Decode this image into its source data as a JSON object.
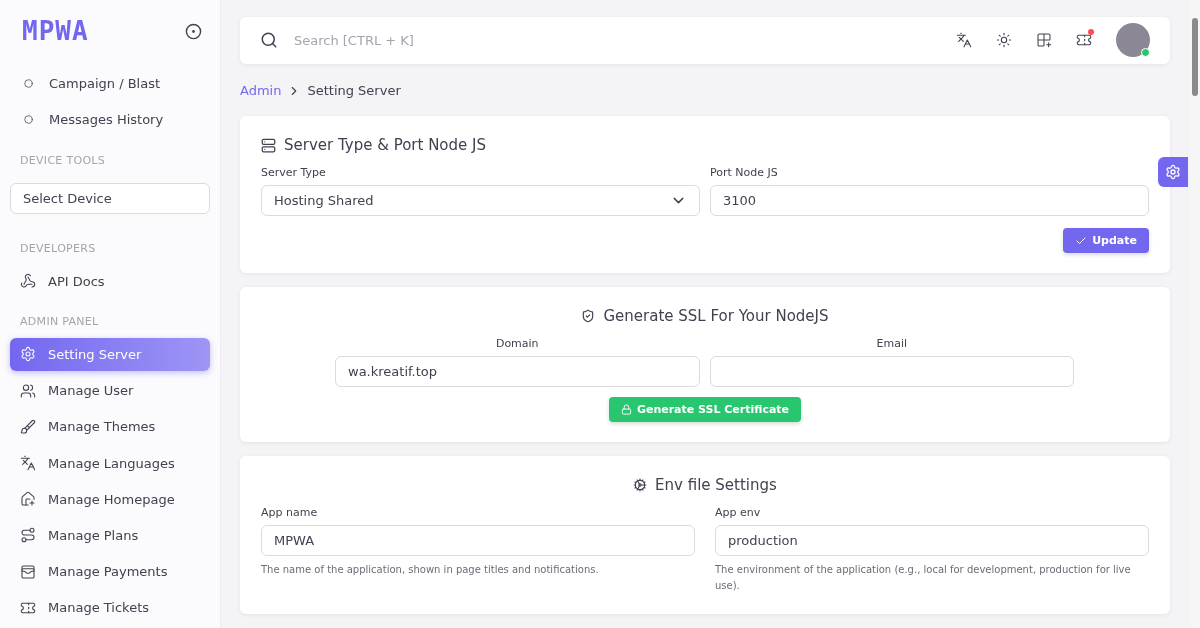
{
  "sidebar": {
    "logo": "MPWA",
    "items": [
      {
        "kind": "sub",
        "label": "Campaign / Blast",
        "selected": false
      },
      {
        "kind": "sub",
        "label": "Messages History",
        "selected": false
      },
      {
        "kind": "heading",
        "label": "DEVICE TOOLS"
      },
      {
        "kind": "select",
        "label": "Select Device"
      },
      {
        "kind": "heading",
        "label": "DEVELOPERS"
      },
      {
        "kind": "link",
        "label": "API Docs",
        "selected": false
      },
      {
        "kind": "heading",
        "label": "ADMIN PANEL"
      },
      {
        "kind": "link",
        "label": "Setting Server",
        "selected": true
      },
      {
        "kind": "link",
        "label": "Manage User",
        "selected": false
      },
      {
        "kind": "link",
        "label": "Manage Themes",
        "selected": false
      },
      {
        "kind": "link",
        "label": "Manage Languages",
        "selected": false
      },
      {
        "kind": "link",
        "label": "Manage Homepage",
        "selected": false
      },
      {
        "kind": "link",
        "label": "Manage Plans",
        "selected": false
      },
      {
        "kind": "link",
        "label": "Manage Payments",
        "selected": false
      },
      {
        "kind": "link",
        "label": "Manage Tickets",
        "selected": false
      }
    ]
  },
  "topbar": {
    "search": {
      "placeholder": "Search [CTRL + K]"
    },
    "notification": true,
    "online": true
  },
  "breadcrumb": [
    {
      "label": "Admin",
      "selected": false
    },
    {
      "label": "Setting Server",
      "selected": true
    }
  ],
  "server_card": {
    "title": "Server Type & Port Node JS",
    "fields": [
      {
        "kind": "select",
        "label": "Server Type",
        "value": "Hosting Shared"
      },
      {
        "kind": "input",
        "label": "Port Node JS",
        "value": "3100"
      }
    ],
    "button": "Update"
  },
  "ssl_card": {
    "title": "Generate SSL For Your NodeJS",
    "fields": [
      {
        "label": "Domain",
        "value": "wa.kreatif.top"
      },
      {
        "label": "Email"
      }
    ],
    "button": "Generate SSL Certificate"
  },
  "env_card": {
    "title": "Env file Settings",
    "fields": [
      {
        "label": "App name",
        "value": "MPWA",
        "help": "The name of the application, shown in page titles and notifications."
      },
      {
        "label": "App env",
        "value": "production",
        "help": "The environment of the application (e.g., local for development, production for live use)."
      }
    ]
  }
}
